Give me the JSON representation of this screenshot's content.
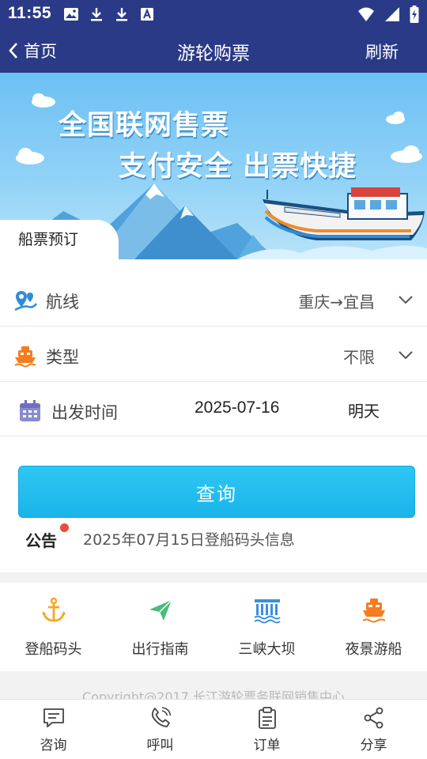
{
  "status_bar": {
    "time": "11:55",
    "icons_left": [
      "image-icon",
      "download-icon",
      "download-icon",
      "a-keyboard-icon"
    ],
    "icons_right": [
      "wifi-icon",
      "signal-icon",
      "battery-charging-icon"
    ]
  },
  "nav": {
    "back_label": "首页",
    "title": "游轮购票",
    "refresh_label": "刷新",
    "color": "#2a3a86"
  },
  "banner": {
    "line1": "全国联网售票",
    "line2": "支付安全 出票快捷",
    "tab_label": "船票预订"
  },
  "form": {
    "route": {
      "label": "航线",
      "value": "重庆→宜昌",
      "icon": "route-pin-icon"
    },
    "type": {
      "label": "类型",
      "value": "不限",
      "icon": "ship-icon"
    },
    "departure": {
      "label": "出发时间",
      "date": "2025-07-16",
      "relative": "明天",
      "icon": "calendar-icon"
    },
    "query_label": "查询",
    "notice_label": "公告",
    "notice_text": "2025年07月15日登船码头信息"
  },
  "quick_links": [
    {
      "label": "登船码头",
      "icon": "anchor-icon",
      "color": "#f5a623"
    },
    {
      "label": "出行指南",
      "icon": "paper-plane-icon",
      "color": "#4dbb7a"
    },
    {
      "label": "三峡大坝",
      "icon": "dam-icon",
      "color": "#3b8fe0"
    },
    {
      "label": "夜景游船",
      "icon": "ship-icon",
      "color": "#f57c1f"
    }
  ],
  "copyright": "Copyright@2017 长江游轮票务联网销售中心",
  "tab_bar": [
    {
      "label": "咨询",
      "icon": "chat-icon"
    },
    {
      "label": "呼叫",
      "icon": "phone-icon"
    },
    {
      "label": "订单",
      "icon": "clipboard-icon"
    },
    {
      "label": "分享",
      "icon": "share-icon"
    }
  ],
  "colors": {
    "accent": "#1ab4ea",
    "header": "#2a3a86",
    "notice_dot": "#f04a3a"
  }
}
